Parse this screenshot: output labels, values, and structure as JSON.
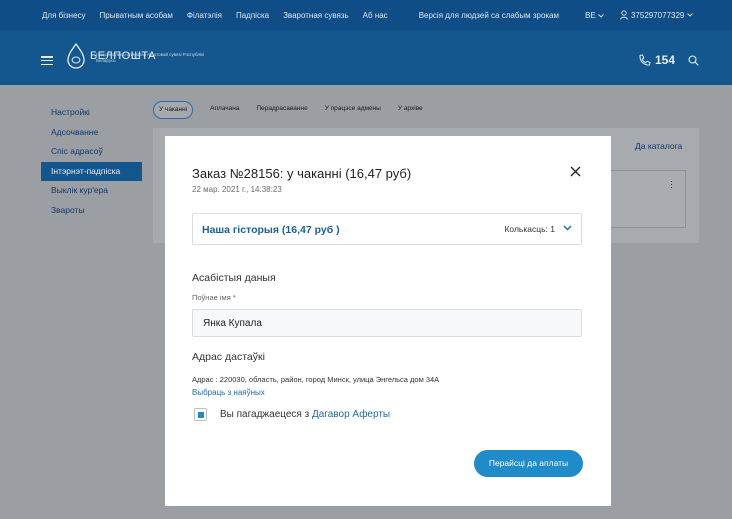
{
  "topbar": {
    "links": [
      "Для бізнесу",
      "Прыватным асобам",
      "Філатэлія",
      "Падпіска",
      "Зваротная сувязь",
      "Аб нас"
    ],
    "accessibility": "Версія для людзей са слабым зрокам",
    "language": "BE",
    "phone": "375297077329"
  },
  "header": {
    "logo_text": "БЕЛПОШТА",
    "logo_subtitle": "Нацыянальны аператар паштовай сувязі Рэспублікі Беларусь",
    "hotline": "154"
  },
  "sidebar": {
    "items": [
      {
        "label": "Настройкі",
        "active": false
      },
      {
        "label": "Адсочванне",
        "active": false
      },
      {
        "label": "Спіс адрасоў",
        "active": false
      },
      {
        "label": "Інтэрнэт-падпіска",
        "active": true
      },
      {
        "label": "Выклік кур'ера",
        "active": false
      },
      {
        "label": "Звароты",
        "active": false
      }
    ]
  },
  "tabs": [
    {
      "label": "У чаканні",
      "active": true
    },
    {
      "label": "Аплачана",
      "active": false
    },
    {
      "label": "Перадрасаванне",
      "active": false
    },
    {
      "label": "У працэсе адмены",
      "active": false
    },
    {
      "label": "У архіве",
      "active": false
    }
  ],
  "main": {
    "catalog_link": "Да каталога"
  },
  "modal": {
    "title": "Заказ №28156: у чаканні (16,47 руб)",
    "date": "22 мар. 2021 г., 14:38:23",
    "item": {
      "title": "Наша гісторыя (16,47 руб )",
      "quantity": "Колькасць: 1"
    },
    "personal_heading": "Асабістыя даныя",
    "name_label": "Поўнае імя *",
    "name_value": "Янка Купала",
    "delivery_heading": "Адрас дастаўкі",
    "address": "Адрас : 220030, область, район, город Минск, улица Энгельса дом 34А",
    "choose_link": "Выбраць з наяўных",
    "agree_text": "Вы пагаджаецеся з ",
    "agree_link": "Дагавор Аферты",
    "agree_checked": true,
    "pay_button": "Перайсці да аплаты"
  },
  "colors": {
    "topbar": "#0f4d86",
    "header": "#14578f",
    "accent": "#1f8cc9",
    "link": "#1c6aa8"
  }
}
